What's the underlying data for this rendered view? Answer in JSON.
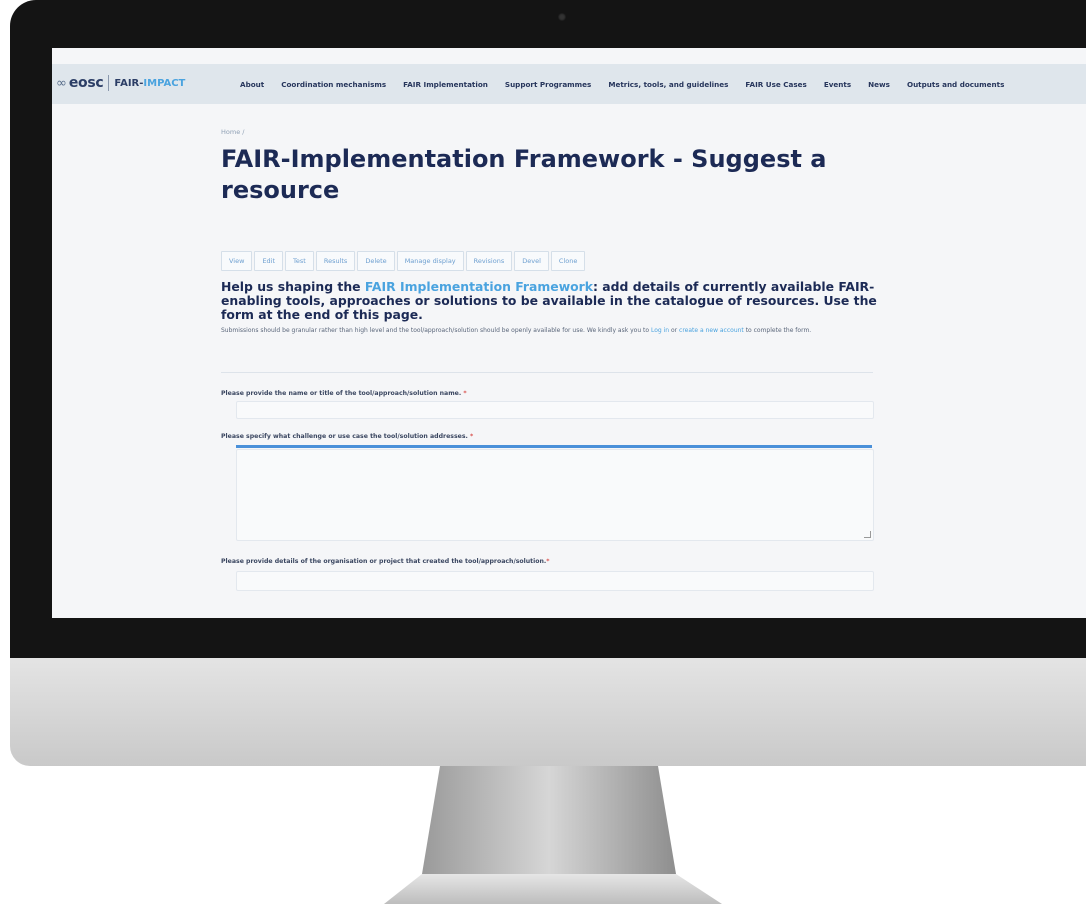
{
  "header": {
    "logo_mark": "∞",
    "logo_eosc": "eosc",
    "logo_fair": "FAIR-",
    "logo_impact": "IMPACT",
    "nav": [
      "About",
      "Coordination mechanisms",
      "FAIR Implementation",
      "Support Programmes",
      "Metrics, tools, and guidelines",
      "FAIR Use Cases",
      "Events",
      "News",
      "Outputs and documents"
    ]
  },
  "breadcrumb": "Home /",
  "page_title": "FAIR-Implementation Framework - Suggest a resource",
  "tabs": [
    "View",
    "Edit",
    "Test",
    "Results",
    "Delete",
    "Manage display",
    "Revisions",
    "Devel",
    "Clone"
  ],
  "intro": {
    "heading_prefix": "Help us shaping the ",
    "heading_link": "FAIR Implementation Framework",
    "heading_suffix": ": add details of currently available FAIR-enabling tools, approaches or solutions to be available in the catalogue of resources. Use the form at the end of this page.",
    "text_prefix": "Submissions should be granular rather than high level and the tool/approach/solution should be openly available for use. We kindly ask you to ",
    "login_link": "Log in",
    "text_or": " or ",
    "create_link": "create a new account",
    "text_suffix": " to complete the form."
  },
  "form": {
    "field1_label": "Please provide the name or title of the tool/approach/solution name.",
    "field2_label": "Please specify what challenge or use case the tool/solution addresses.",
    "field3_label": "Please provide details of the organisation or project that created the tool/approach/solution.",
    "required_marker": "*"
  },
  "colors": {
    "brand_dark": "#1c2a55",
    "accent": "#4aa3df",
    "navbar_bg": "#dfe6ec"
  }
}
